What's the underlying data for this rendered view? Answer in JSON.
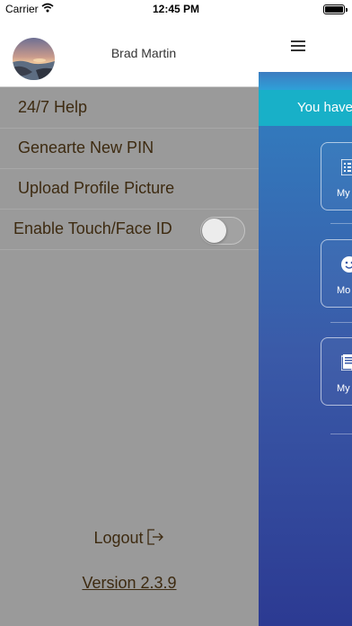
{
  "status_bar": {
    "carrier": "Carrier",
    "time": "12:45 PM"
  },
  "drawer": {
    "user_name": "Brad Martin",
    "menu_items": [
      {
        "label": "24/7 Help"
      },
      {
        "label": "Genearte New PIN"
      },
      {
        "label": "Upload Profile Picture"
      },
      {
        "label": "Enable Touch/Face ID",
        "toggle_on": false
      }
    ],
    "logout_label": "Logout",
    "version_label": "Version 2.3.9"
  },
  "main": {
    "banner_text": "You have",
    "tiles": [
      {
        "icon": "grid-icon",
        "label": "My"
      },
      {
        "icon": "smiley-icon",
        "label": "Mo"
      },
      {
        "icon": "document-icon",
        "label": "My C"
      }
    ]
  },
  "colors": {
    "drawer_bg": "#9a9a9a",
    "menu_text": "#3d2a10",
    "banner_bg": "#18b0c8",
    "gradient_top": "#2f88c6",
    "gradient_bottom": "#2c3a92"
  }
}
